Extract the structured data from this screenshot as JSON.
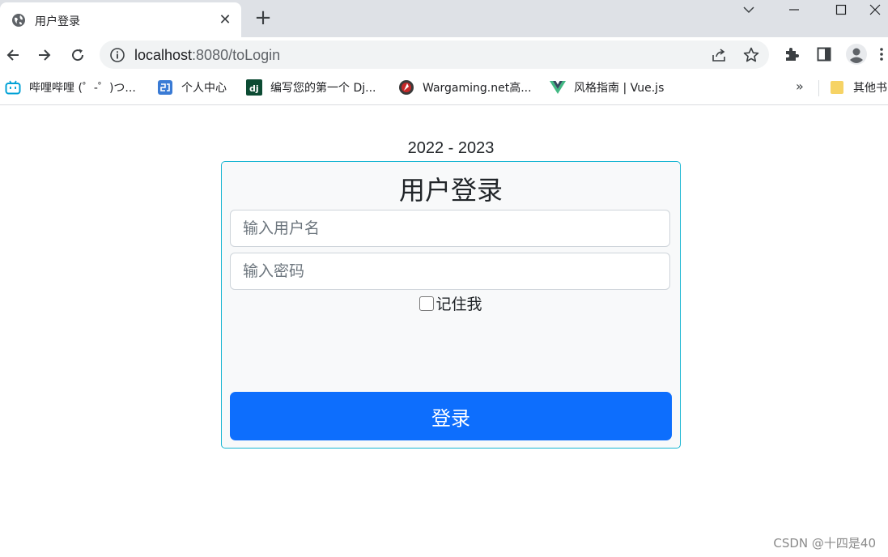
{
  "browser": {
    "tab": {
      "title": "用户登录",
      "close_glyph": "✕",
      "favicon": "globe-icon"
    },
    "new_tab_glyph": "+",
    "address": {
      "host": "localhost",
      "port_path": ":8080/toLogin"
    },
    "bookmarks": [
      {
        "label": "哔哩哔哩 (゜-゜)つ...",
        "icon": "bilibili-icon",
        "color": "#00a1d6"
      },
      {
        "label": "个人中心",
        "icon": "profile-center-icon",
        "color": "#3a7bd5"
      },
      {
        "label": "编写您的第一个 Dj...",
        "icon": "django-icon",
        "color": "#0c4b33"
      },
      {
        "label": "Wargaming.net高...",
        "icon": "wargaming-icon",
        "color": "#c62828"
      },
      {
        "label": "风格指南 | Vue.js",
        "icon": "vue-icon",
        "color": "#42b883"
      }
    ],
    "bookmarks_more": "»",
    "other_bookmarks": {
      "label": "其他书",
      "icon": "folder-icon",
      "color": "#f6d365"
    }
  },
  "page": {
    "years": "2022 - 2023",
    "form": {
      "title": "用户登录",
      "username_placeholder": "输入用户名",
      "password_placeholder": "输入密码",
      "remember_label": "记住我",
      "submit_label": "登录"
    },
    "colors": {
      "card_border": "#17b5d2",
      "primary": "#0d6efd",
      "card_bg": "#f8f9fa"
    }
  },
  "watermark": "CSDN @十四是40"
}
